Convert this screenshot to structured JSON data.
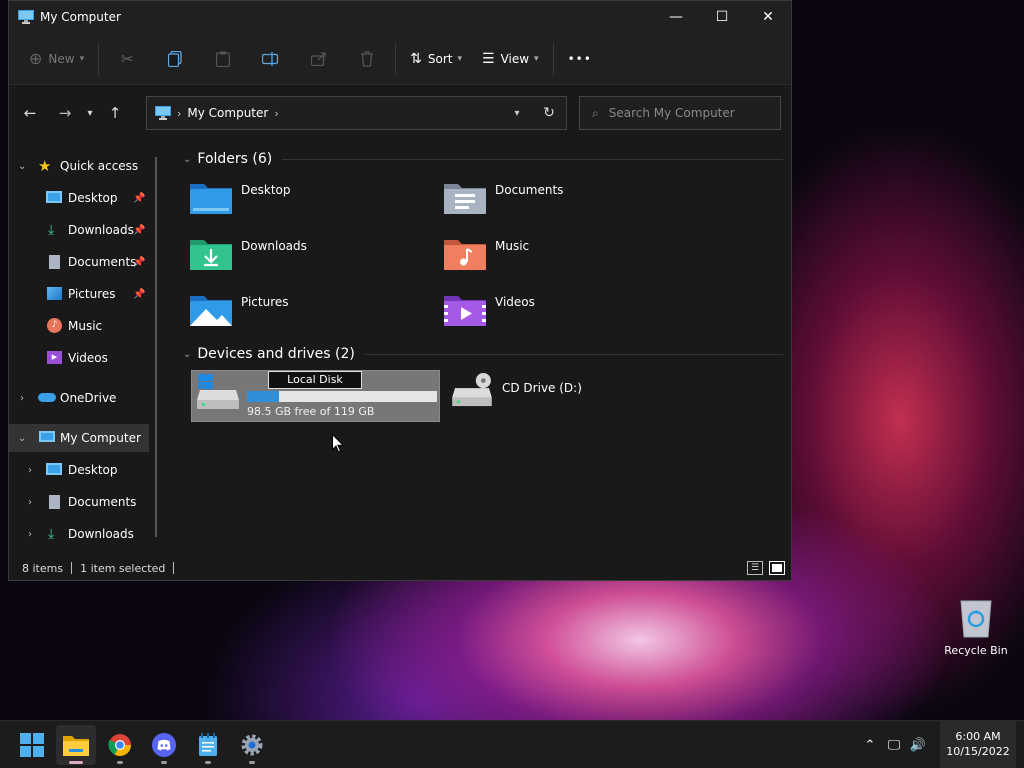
{
  "window": {
    "title": "My Computer",
    "controls": {
      "minimize": "—",
      "maximize": "☐",
      "close": "✕"
    }
  },
  "toolbar": {
    "new_label": "New",
    "sort_label": "Sort",
    "view_label": "View",
    "more_label": "•••"
  },
  "address": {
    "path": "My Computer",
    "search_placeholder": "Search My Computer"
  },
  "sidebar": {
    "quick_access": "Quick access",
    "items": [
      {
        "label": "Desktop",
        "pinned": true
      },
      {
        "label": "Downloads",
        "pinned": true
      },
      {
        "label": "Documents",
        "pinned": true
      },
      {
        "label": "Pictures",
        "pinned": true
      },
      {
        "label": "Music",
        "pinned": false
      },
      {
        "label": "Videos",
        "pinned": false
      }
    ],
    "onedrive": "OneDrive",
    "my_computer": "My Computer",
    "sub_items": [
      "Desktop",
      "Documents",
      "Downloads"
    ]
  },
  "content": {
    "folders_header": "Folders (6)",
    "folders": [
      "Desktop",
      "Documents",
      "Downloads",
      "Music",
      "Pictures",
      "Videos"
    ],
    "devices_header": "Devices and drives (2)",
    "drive_c": {
      "rename_value": "Local Disk",
      "free_text": "98.5 GB free of 119 GB",
      "used_fraction": 0.17
    },
    "drive_d": {
      "label": "CD Drive (D:)"
    }
  },
  "status": {
    "items": "8 items",
    "selected": "1 item selected"
  },
  "desktop": {
    "recycle_bin": "Recycle Bin"
  },
  "taskbar": {
    "time": "6:00 AM",
    "date": "10/15/2022"
  },
  "colors": {
    "accent": "#2f8fd8",
    "window_bg": "#191919",
    "selection": "#777777"
  }
}
